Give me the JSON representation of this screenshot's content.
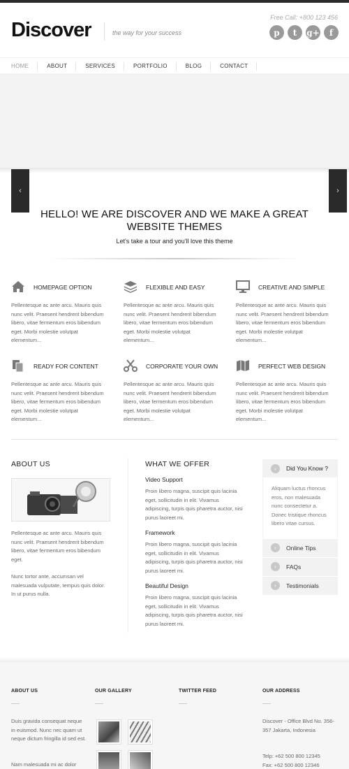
{
  "header": {
    "logo": "Discover",
    "tagline": "the way for your success",
    "free_call": "Free Call: +800 123 456",
    "social": [
      {
        "icon": "pinterest-icon",
        "glyph": "p"
      },
      {
        "icon": "twitter-icon",
        "glyph": "t"
      },
      {
        "icon": "google-plus-icon",
        "glyph": "g+"
      },
      {
        "icon": "facebook-icon",
        "glyph": "f"
      }
    ]
  },
  "nav": {
    "items": [
      "HOME",
      "ABOUT",
      "SERVICES",
      "PORTFOLIO",
      "BLOG",
      "CONTACT"
    ]
  },
  "hero": {
    "heading": "HELLO! WE ARE DISCOVER AND WE MAKE A GREAT WEBSITE THEMES",
    "subheading": "Let's take a tour and you'll love this theme",
    "prev": "‹",
    "next": "›"
  },
  "features": [
    {
      "title": "HOMEPAGE OPTION",
      "icon": "home-icon",
      "text": "Pellentesque ac ante arcu. Mauris quis nunc velit. Praesent hendrerit bibendum libero, vitae fermentum eros bibendum eget. Morbi molestie volutpat elementum..."
    },
    {
      "title": "FLEXIBLE AND EASY",
      "icon": "layers-icon",
      "text": "Pellentesque ac ante arcu. Mauris quis nunc velit. Praesent hendrerit bibendum libero, vitae fermentum eros bibendum eget. Morbi molestie volutpat elementum..."
    },
    {
      "title": "CREATIVE AND SIMPLE",
      "icon": "monitor-icon",
      "text": "Pellentesque ac ante arcu. Mauris quis nunc velit. Praesent hendrerit bibendum libero, vitae fermentum eros bibendum eget. Morbi molestie volutpat elementum..."
    },
    {
      "title": "READY FOR CONTENT",
      "icon": "documents-icon",
      "text": "Pellentesque ac ante arcu. Mauris quis nunc velit. Praesent hendrerit bibendum libero, vitae fermentum eros bibendum eget. Morbi molestie volutpat elementum..."
    },
    {
      "title": "CORPORATE YOUR OWN",
      "icon": "scissors-icon",
      "text": "Pellentesque ac ante arcu. Mauris quis nunc velit. Praesent hendrerit bibendum libero, vitae fermentum eros bibendum eget. Morbi molestie volutpat elementum..."
    },
    {
      "title": "PERFECT WEB DESIGN",
      "icon": "map-icon",
      "text": "Pellentesque ac ante arcu. Mauris quis nunc velit. Praesent hendrerit bibendum libero, vitae fermentum eros bibendum eget. Morbi molestie volutpat elementum..."
    }
  ],
  "about": {
    "title": "ABOUT US",
    "para1": "Pellentesque ac ante arcu. Mauris quis nunc velit. Praesent hendrerit bibendum libero, vitae fermentum eros bibendum eget.",
    "para2": "Nunc tortor ante, accumsan vel malesuada vulputate, tempus quis dolor. In ut purus nulla."
  },
  "offer": {
    "title": "WHAT WE OFFER",
    "items": [
      {
        "title": "Video Support",
        "text": "Proin libero magna, suscipit quis lacinia eget, sollicitudin in elit. Vivamus adipiscing, turpis quis pharetra auctor, nisi purus laoreet mi."
      },
      {
        "title": "Framework",
        "text": "Proin libero magna, suscipit quis lacinia eget, sollicitudin in elit. Vivamus adipiscing, turpis quis pharetra auctor, nisi purus laoreet mi."
      },
      {
        "title": "Beautiful Design",
        "text": "Proin libero magna, suscipit quis lacinia eget, sollicitudin in elit. Vivamus adipiscing, turpis quis pharetra auctor, nisi purus laoreet mi."
      }
    ]
  },
  "sidebar": {
    "head": "Did You Know ?",
    "body": "Aliquam luctus rhoncus eros, non malesuada nunc consectetur a. Donec tristique rhoncus libero vitae cursus.",
    "items": [
      "Online Tips",
      "FAQs",
      "Testimonials"
    ]
  },
  "footer": {
    "about_title": "ABOUT US",
    "about_text": "Duis gravida consequat neque in euismod. Nunc nec quam ut neque dictum fringilla id sed est.",
    "about_text2": "Nam malesuada mi ac dolor",
    "gallery_title": "OUR GALLERY",
    "twitter_title": "TWITTER FEED",
    "address_title": "OUR ADDRESS",
    "address": "Discover - Office Blvd No. 356-357 Jakarta, Indonesia",
    "tel": "Telp: +62 500 800 12345",
    "fax": "Fax: +62 500 800 12346"
  }
}
